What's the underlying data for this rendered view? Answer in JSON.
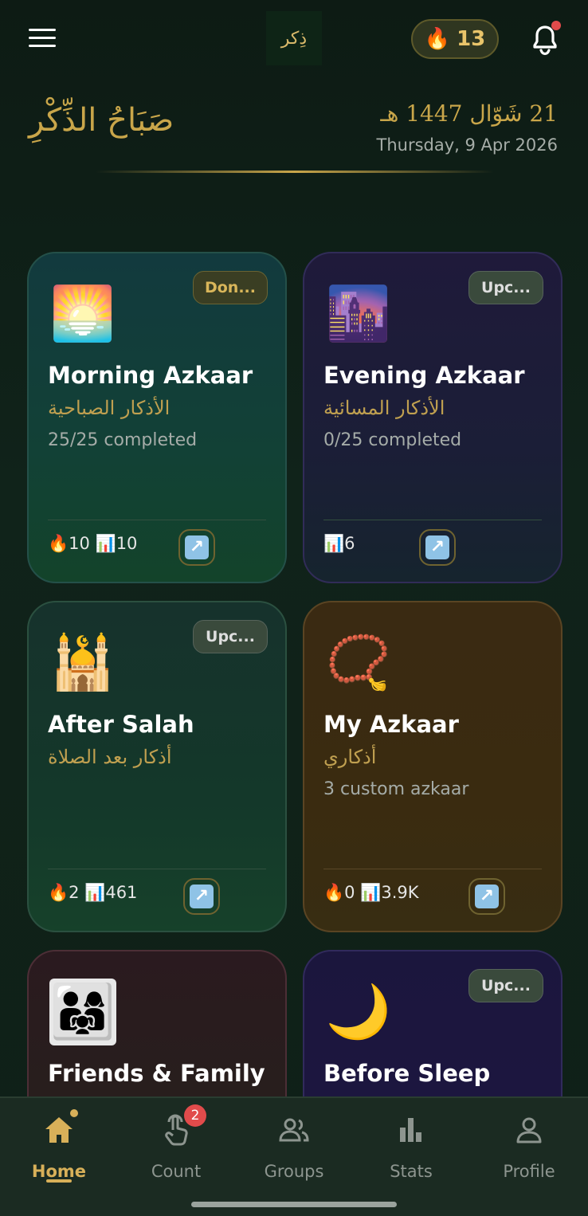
{
  "header": {
    "logo_text": "ذِكر",
    "streak_count": "13",
    "streak_icon": "🔥",
    "notification_dot": true
  },
  "greeting": {
    "arabic": "صَبَاحُ الذِّكْرِ",
    "hijri_date": "21 شَوّال 1447 هـ",
    "gregorian_date": "Thursday, 9 Apr 2026"
  },
  "cards": [
    {
      "icon": "🌅",
      "badge": "Don...",
      "title": "Morning Azkaar",
      "arabic": "الأذكار الصباحية",
      "subtitle": "25/25 completed",
      "stats": "🔥10 📊10",
      "open_icon": "↗"
    },
    {
      "icon": "🌆",
      "badge": "Upc...",
      "title": "Evening Azkaar",
      "arabic": "الأذكار المسائية",
      "subtitle": "0/25 completed",
      "stats": "📊6",
      "open_icon": "↗"
    },
    {
      "icon": "🕌",
      "badge": "Upc...",
      "title": "After Salah",
      "arabic": "أذكار بعد الصلاة",
      "subtitle": "",
      "stats": "🔥2 📊461",
      "open_icon": "↗"
    },
    {
      "icon": "📿",
      "badge": "",
      "title": "My Azkaar",
      "arabic": "أذكاري",
      "subtitle": "3 custom azkaar",
      "stats": "🔥0 📊3.9K",
      "open_icon": "↗"
    },
    {
      "icon": "👨‍👩‍👧",
      "badge": "",
      "title": "Friends & Family",
      "arabic": "",
      "subtitle": "",
      "stats": "",
      "open_icon": ""
    },
    {
      "icon": "🌙",
      "badge": "Upc...",
      "title": "Before Sleep",
      "arabic": "",
      "subtitle": "",
      "stats": "",
      "open_icon": ""
    }
  ],
  "nav": {
    "items": [
      {
        "label": "Home",
        "icon": "home-icon",
        "active": true
      },
      {
        "label": "Count",
        "icon": "tap-icon",
        "badge": "2"
      },
      {
        "label": "Groups",
        "icon": "groups-icon"
      },
      {
        "label": "Stats",
        "icon": "stats-icon"
      },
      {
        "label": "Profile",
        "icon": "profile-icon"
      }
    ]
  },
  "colors": {
    "accent_gold": "#c9a64a",
    "background": "#0f1f18",
    "badge_red": "#e14b4b"
  }
}
